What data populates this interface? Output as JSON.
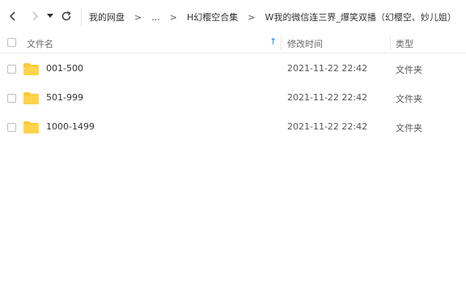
{
  "breadcrumb": {
    "items": [
      "我的网盘",
      "...",
      "H幻樱空合集",
      "W我的微信连三界_爆笑双播（幻樱空、妙儿姐）"
    ],
    "separator": ">"
  },
  "table": {
    "headers": {
      "name": "文件名",
      "mtime": "修改时间",
      "type": "类型"
    },
    "sort_indicator": "↑",
    "rows": [
      {
        "name": "001-500",
        "mtime": "2021-11-22 22:42",
        "type": "文件夹"
      },
      {
        "name": "501-999",
        "mtime": "2021-11-22 22:42",
        "type": "文件夹"
      },
      {
        "name": "1000-1499",
        "mtime": "2021-11-22 22:42",
        "type": "文件夹"
      }
    ]
  },
  "colors": {
    "folder": "#ffc933",
    "accent": "#1a8cff"
  },
  "icons": [
    "back-arrow-icon",
    "forward-arrow-icon",
    "dropdown-caret-icon",
    "refresh-icon",
    "folder-icon",
    "sort-up-icon"
  ]
}
